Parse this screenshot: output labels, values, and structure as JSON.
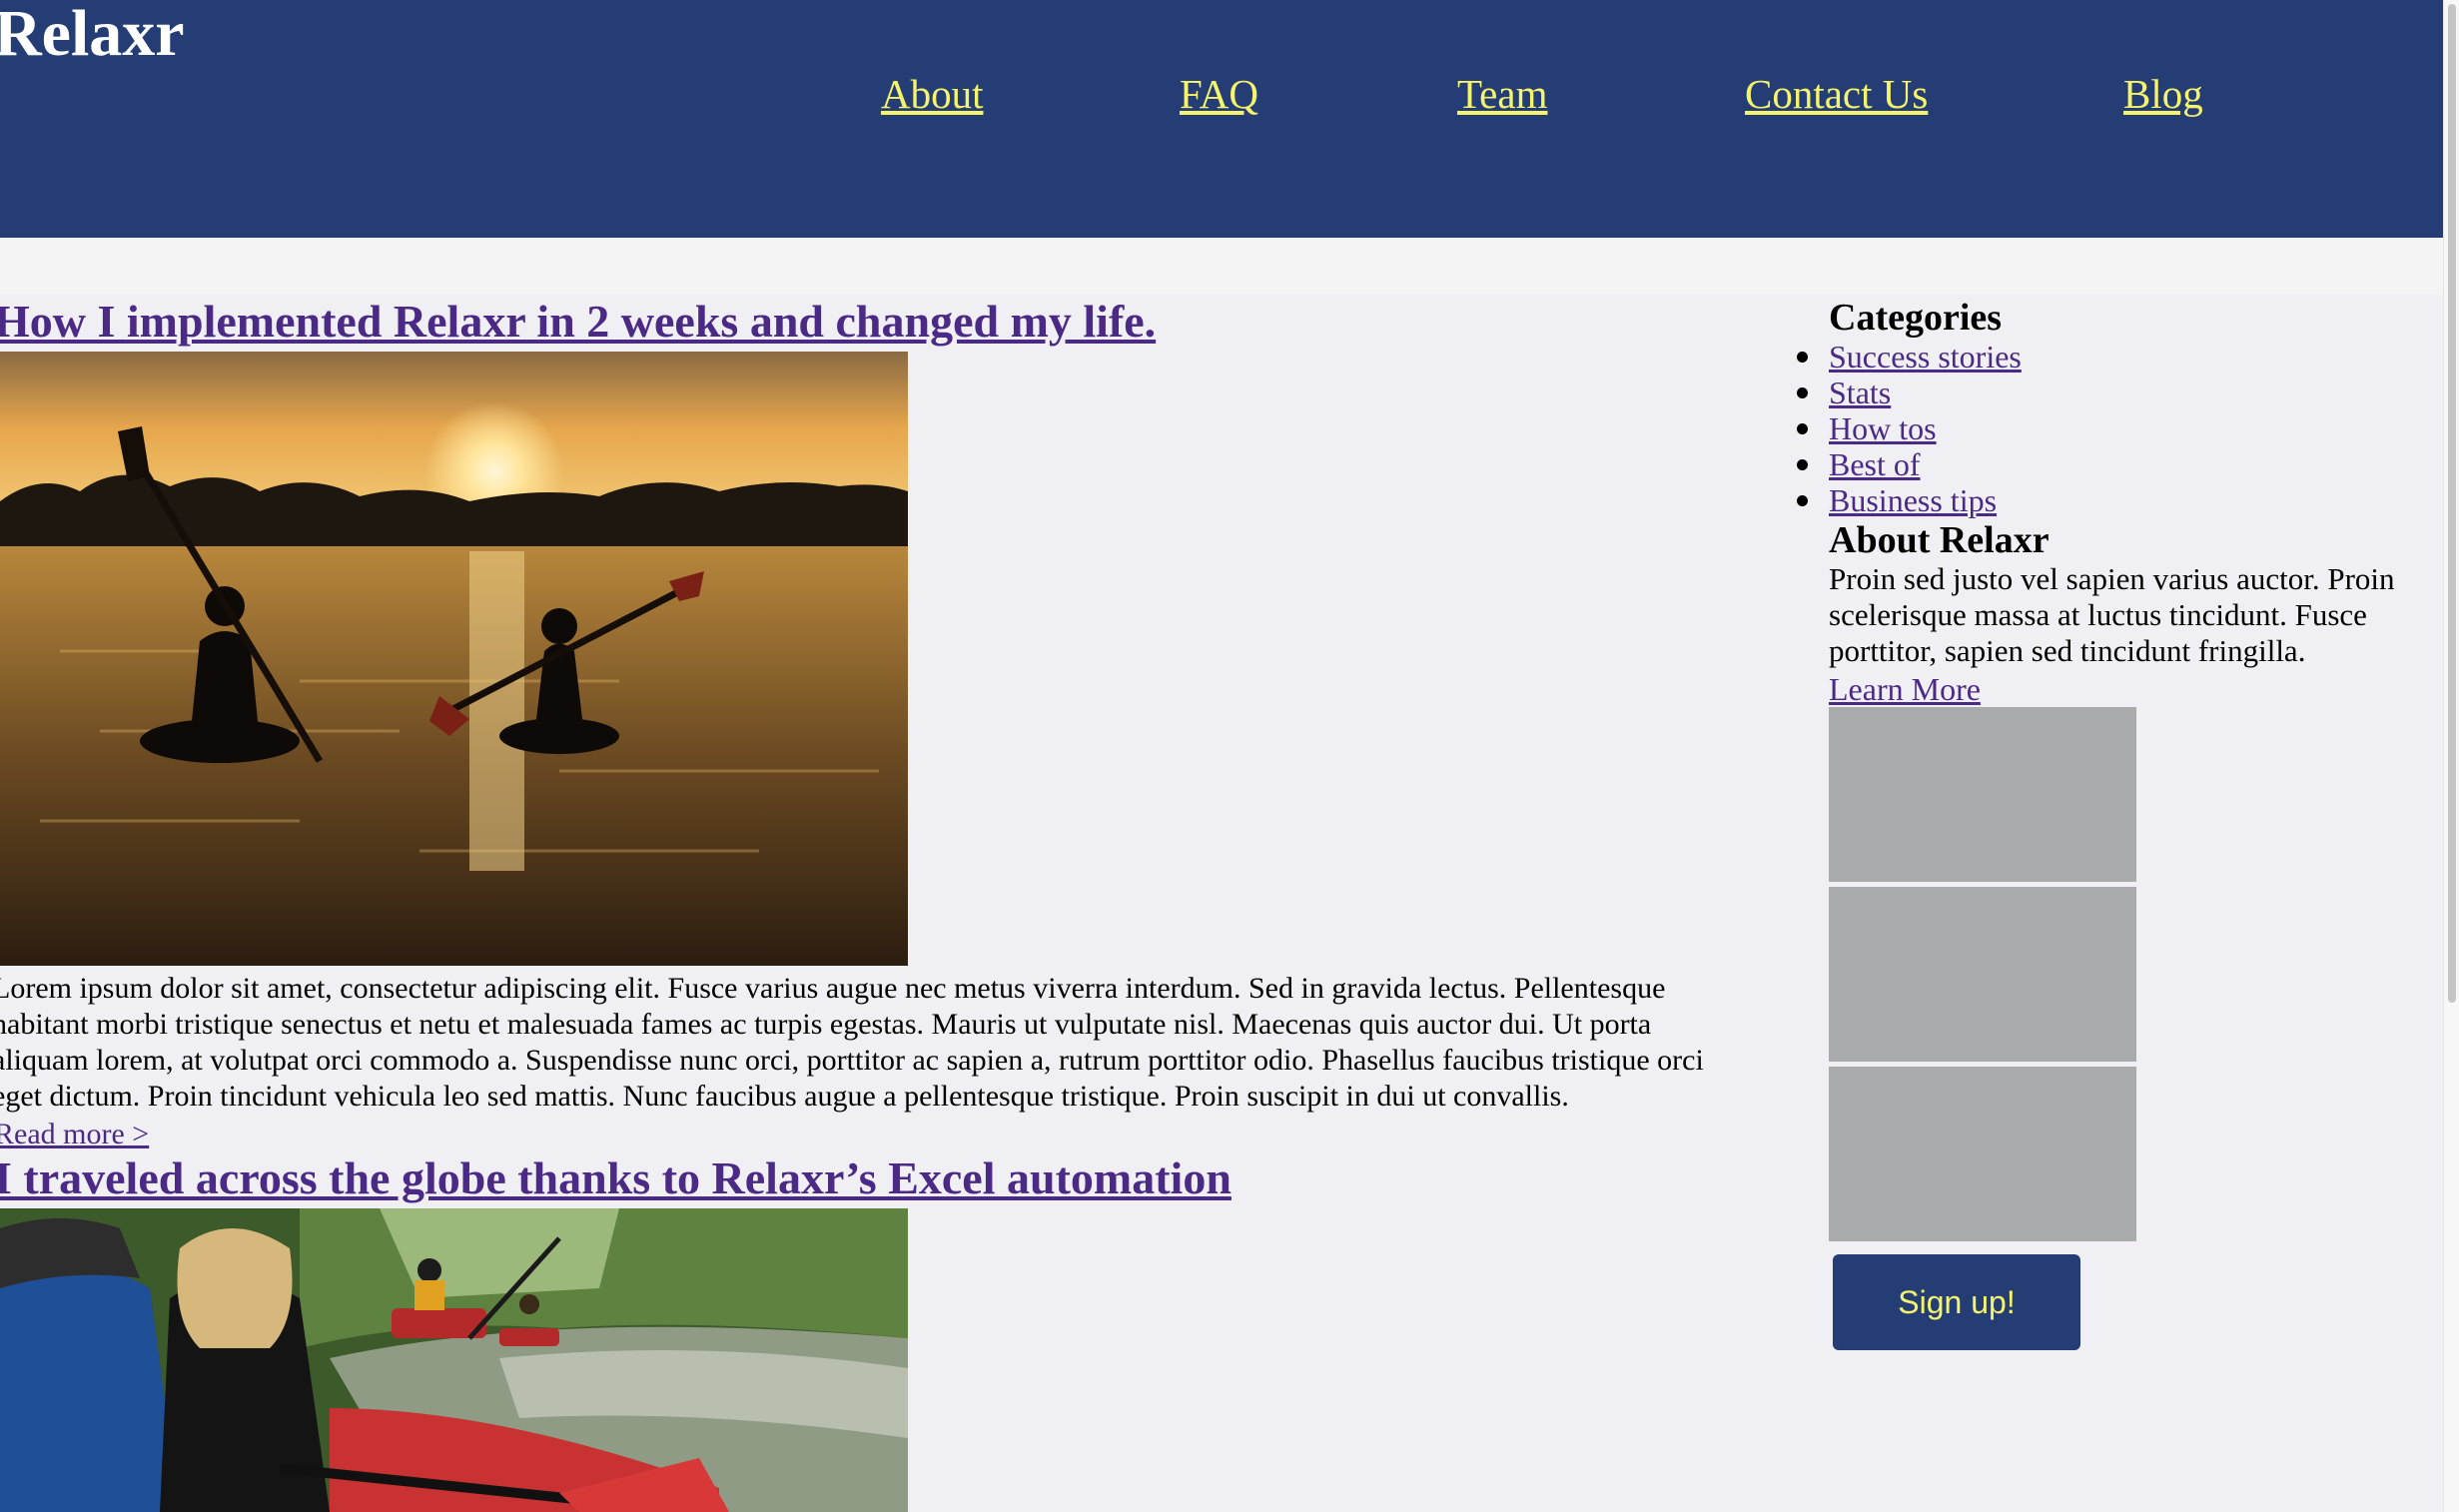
{
  "site": {
    "title": "Relaxr"
  },
  "nav": [
    {
      "label": "About"
    },
    {
      "label": "FAQ"
    },
    {
      "label": "Team"
    },
    {
      "label": "Contact Us"
    },
    {
      "label": "Blog"
    }
  ],
  "posts": [
    {
      "title": "How I implemented Relaxr in 2 weeks and changed my life.",
      "image": "kayakers-sunset-photo",
      "text_lines": [
        "Lorem ipsum dolor sit amet, consectetur adipiscing elit. Fusce varius augue nec metus viverra interdum. Sed in gravida lectus. Pellentesque",
        "habitant morbi tristique senectus et netu et malesuada fames ac turpis egestas. Mauris ut vulputate nisl. Maecenas quis auctor dui. Ut porta",
        "aliquam lorem, at volutpat orci commodo a. Suspendisse nunc orci, porttitor ac sapien a, rutrum porttitor odio. Phasellus faucibus tristique orci",
        "eget dictum. Proin tincidunt vehicula leo sed mattis. Nunc faucibus augue a pellentesque tristique. Proin suscipit in dui ut convallis."
      ],
      "read_more": "Read more >"
    },
    {
      "title": "I traveled across the globe thanks to Relaxr’s Excel automation",
      "image": "kayak-group-river-photo"
    }
  ],
  "sidebar": {
    "categories_heading": "Categories",
    "categories": [
      {
        "label": "Success stories"
      },
      {
        "label": "Stats"
      },
      {
        "label": "How tos"
      },
      {
        "label": "Best of"
      },
      {
        "label": "Business tips"
      }
    ],
    "about_heading": "About Relaxr",
    "about_text": "Proin sed justo vel sapien varius auctor. Proin scelerisque massa at luctus tincidunt. Fusce porttitor, sapien sed tincidunt fringilla.",
    "learn_more": "Learn More",
    "signup_label": "Sign up!"
  },
  "colors": {
    "header_bg": "#243e75",
    "nav_link": "#f6f36c",
    "link": "#4b2a85",
    "page_bg": "#efeff4",
    "placeholder": "#a8aaac"
  }
}
